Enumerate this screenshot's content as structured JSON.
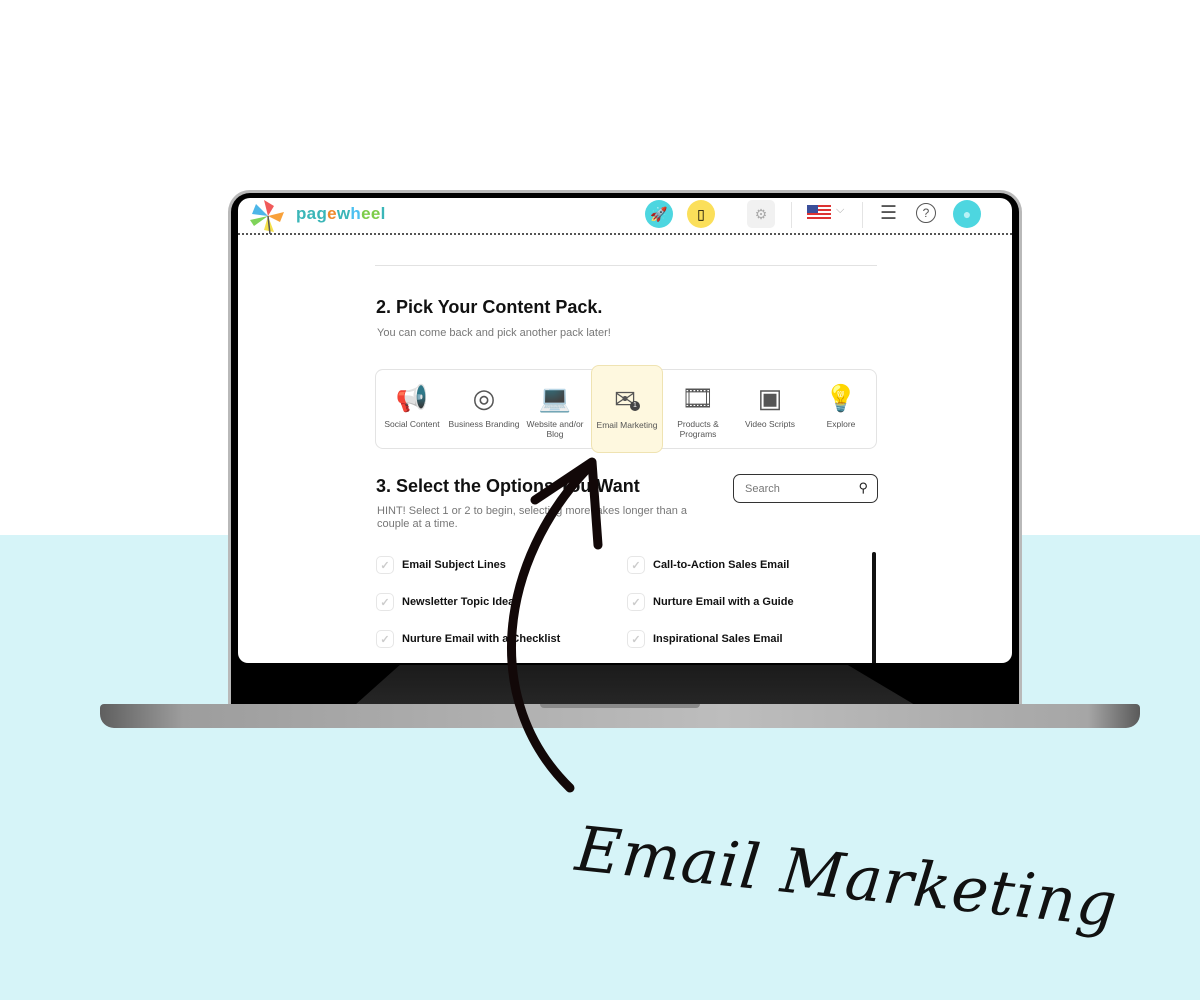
{
  "app": {
    "name": "pagewheel",
    "language_flag": "us-flag-icon"
  },
  "topbar": {
    "icons": [
      "rocket-icon",
      "document-icon",
      "gear-icon",
      "us-flag-icon",
      "chevron-down-icon",
      "list-icon",
      "help-icon",
      "avatar-icon"
    ]
  },
  "section2": {
    "title": "2. Pick Your Content Pack.",
    "subtitle": "You can come back and pick another pack later!"
  },
  "packs": [
    {
      "label": "Social Content",
      "icon": "megaphone-icon"
    },
    {
      "label": "Business Branding",
      "icon": "target-clipboard-icon"
    },
    {
      "label": "Website and/or Blog",
      "icon": "laptop-user-icon"
    },
    {
      "label": "Email Marketing",
      "icon": "envelope-icon",
      "selected": true,
      "badge": "1"
    },
    {
      "label": "Products & Programs",
      "icon": "products-icon"
    },
    {
      "label": "Video Scripts",
      "icon": "video-icon"
    },
    {
      "label": "Explore",
      "icon": "lightbulb-hands-icon"
    }
  ],
  "section3": {
    "title": "3. Select the Options You Want",
    "hint": "HINT! Select 1 or 2 to begin, selecting more takes longer than a couple at a time.",
    "search_placeholder": "Search"
  },
  "options": [
    "Email Subject Lines",
    "Call-to-Action Sales Email",
    "Newsletter Topic Ideas",
    "Nurture Email with a Guide",
    "Nurture Email with a Checklist",
    "Inspirational Sales Email"
  ],
  "annotation": {
    "text": "Email Marketing"
  },
  "colors": {
    "accent_teal": "#4dd6e0",
    "accent_yellow": "#fbdf5a",
    "selected_bg": "#fef8df",
    "background_cyan": "#d6f4f8"
  }
}
